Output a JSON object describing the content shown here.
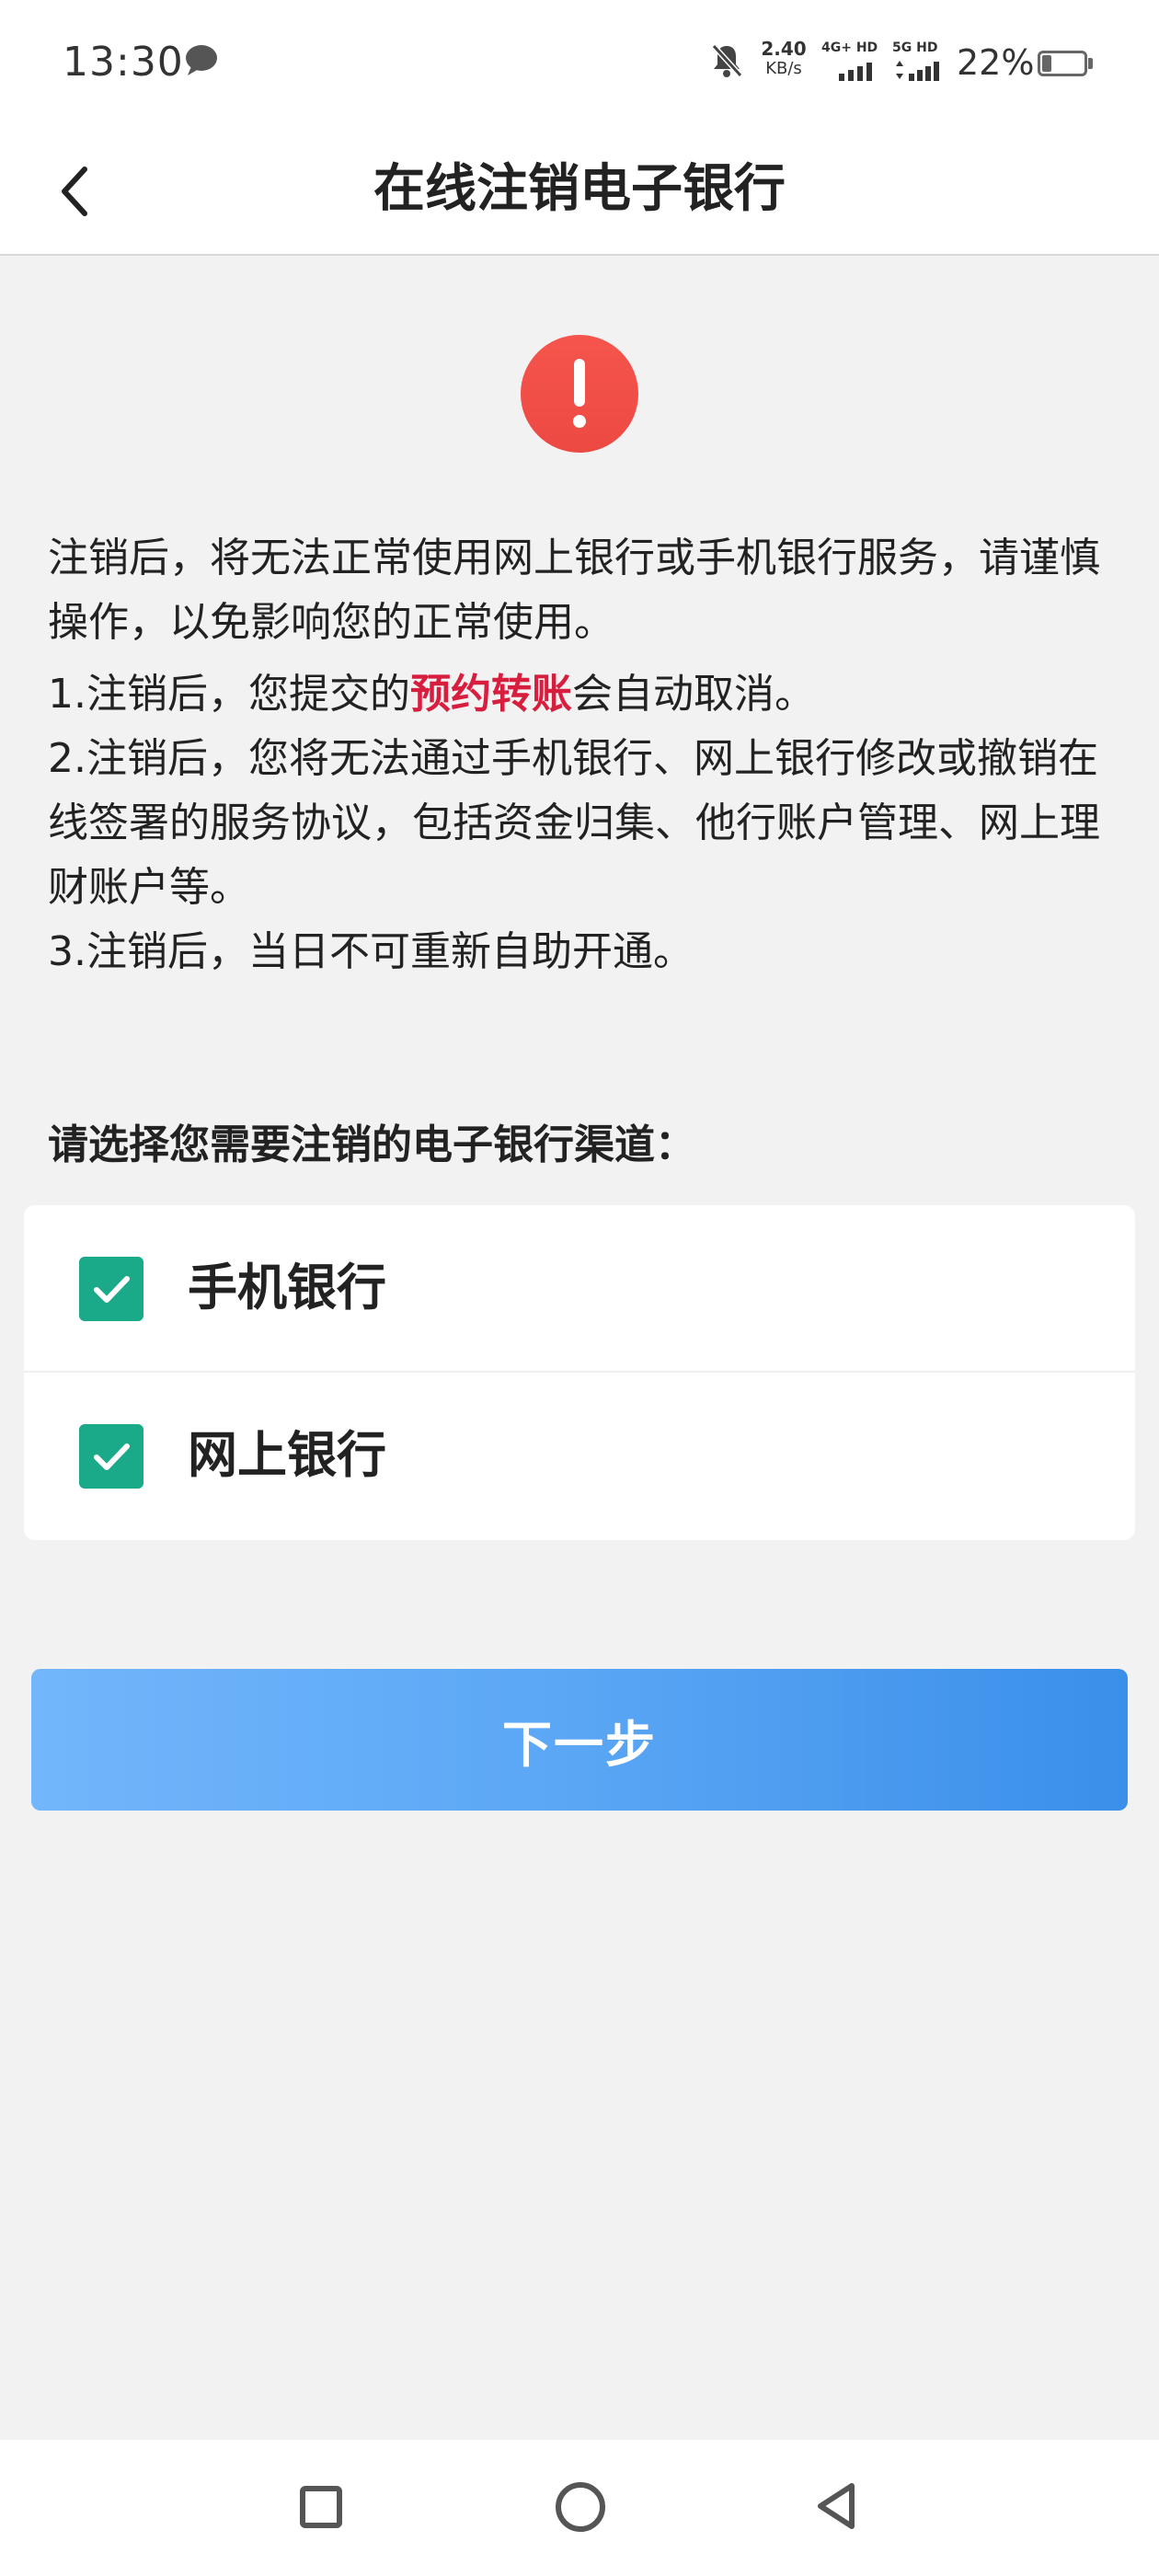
{
  "status_bar": {
    "time": "13:30",
    "net_speed_value": "2.40",
    "net_speed_unit": "KB/s",
    "sim1_label": "4G+ HD",
    "sim2_label": "5G HD",
    "battery_percent": "22%",
    "battery_level": 0.22
  },
  "header": {
    "title": "在线注销电子银行"
  },
  "notice": {
    "intro": "注销后，将无法正常使用网上银行或手机银行服务，请谨慎操作，以免影响您的正常使用。",
    "item1_prefix": "1.注销后，您提交的",
    "item1_highlight": "预约转账",
    "item1_suffix": "会自动取消。",
    "item2": "2.注销后，您将无法通过手机银行、网上银行修改或撤销在线签署的服务协议，包括资金归集、他行账户管理、网上理财账户等。",
    "item3": "3.注销后，当日不可重新自助开通。"
  },
  "selection": {
    "label": "请选择您需要注销的电子银行渠道：",
    "options": [
      {
        "label": "手机银行",
        "checked": true
      },
      {
        "label": "网上银行",
        "checked": true
      }
    ]
  },
  "actions": {
    "next_label": "下一步"
  },
  "colors": {
    "accent_green": "#1aaa8a",
    "highlight_red": "#d81e3f",
    "alert_red": "#f04a44",
    "button_blue_start": "#72b6fb",
    "button_blue_end": "#3a8fe9"
  }
}
